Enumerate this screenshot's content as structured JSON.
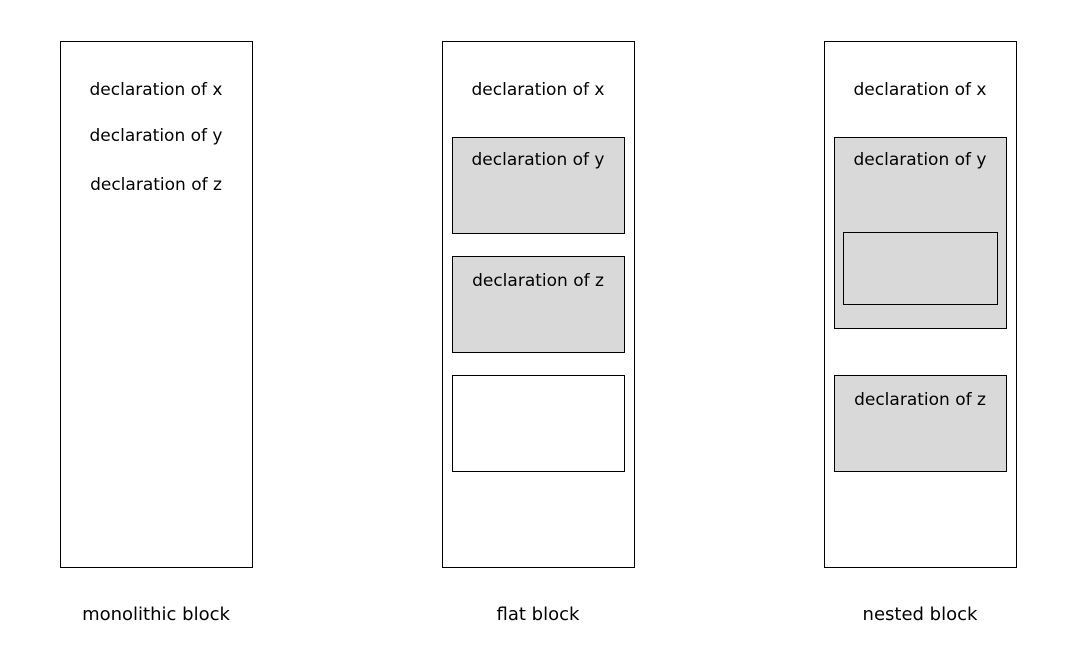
{
  "diagram": {
    "fill_color": "#d9d9d9",
    "panels": {
      "monolithic": {
        "caption": "monolithic block",
        "declarations": [
          "declaration of x",
          "declaration of y",
          "declaration of z"
        ]
      },
      "flat": {
        "caption": "flat block",
        "declaration_x": "declaration of x",
        "block_y_label": "declaration of y",
        "block_z_label": "declaration of z"
      },
      "nested": {
        "caption": "nested block",
        "declaration_x": "declaration of x",
        "block_y_label": "declaration of y",
        "block_z_label": "declaration of z"
      }
    }
  }
}
